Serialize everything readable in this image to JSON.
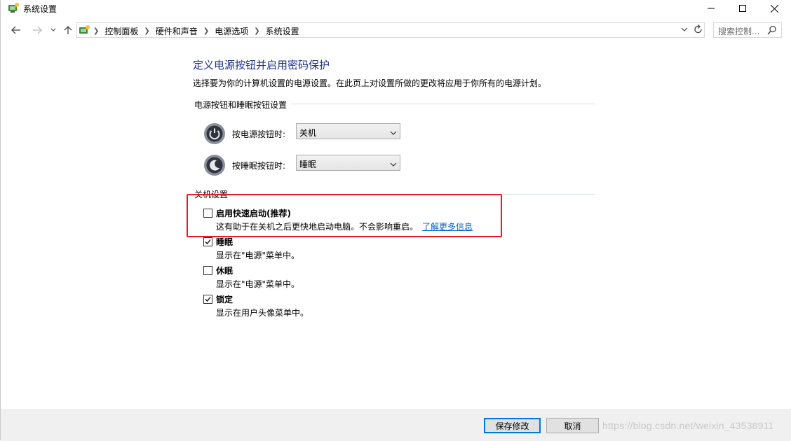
{
  "window": {
    "title": "系统设置"
  },
  "breadcrumb": [
    "控制面板",
    "硬件和声音",
    "电源选项",
    "系统设置"
  ],
  "search": {
    "placeholder": "搜索控制..."
  },
  "page": {
    "title": "定义电源按钮并启用密码保护",
    "description": "选择要为你的计算机设置的电源设置。在此页上对设置所做的更改将应用于你所有的电源计划。"
  },
  "power_group": {
    "header": "电源按钮和睡眠按钮设置",
    "power_button": {
      "label": "按电源按钮时:",
      "value": "关机"
    },
    "sleep_button": {
      "label": "按睡眠按钮时:",
      "value": "睡眠"
    }
  },
  "shutdown_group": {
    "header": "关机设置",
    "items": [
      {
        "label": "启用快速启动(推荐)",
        "desc": "这有助于在关机之后更快地启动电脑。不会影响重启。",
        "link": "了解更多信息",
        "checked": false
      },
      {
        "label": "睡眠",
        "desc": "显示在\"电源\"菜单中。",
        "checked": true
      },
      {
        "label": "休眠",
        "desc": "显示在\"电源\"菜单中。",
        "checked": false
      },
      {
        "label": "锁定",
        "desc": "显示在用户头像菜单中。",
        "checked": true
      }
    ]
  },
  "footer": {
    "save_label": "保存修改",
    "cancel_label": "取消",
    "watermark": "https://blog.csdn.net/weixin_43538911"
  },
  "colors": {
    "title_blue": "#1e3287",
    "link_blue": "#0066cc",
    "highlight_red": "#e02020",
    "focus_blue": "#0078d7"
  }
}
